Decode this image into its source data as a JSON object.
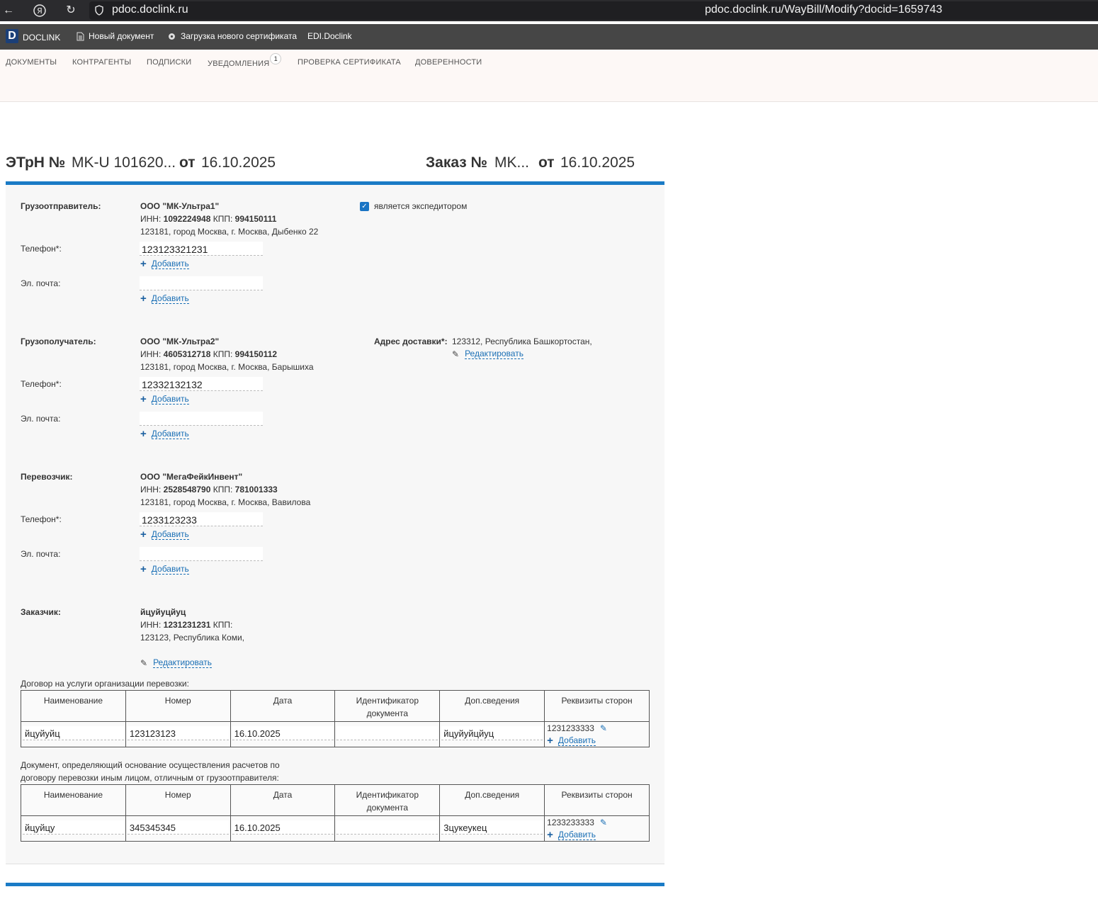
{
  "browser": {
    "host": "pdoc.doclink.ru",
    "url": "pdoc.doclink.ru/WayBill/Modify?docid=1659743"
  },
  "appbar": {
    "logo_letter": "D",
    "brand": "DOCLINK",
    "new_doc": "Новый документ",
    "upload_cert": "Загрузка нового сертификата",
    "edi": "EDI.Doclink"
  },
  "nav": {
    "documents": "ДОКУМЕНТЫ",
    "counterparties": "КОНТРАГЕНТЫ",
    "subscriptions": "ПОДПИСКИ",
    "notifications": "УВЕДОМЛЕНИЯ",
    "notifications_count": "1",
    "cert_check": "ПРОВЕРКА СЕРТИФИКАТА",
    "powers": "ДОВЕРЕННОСТИ"
  },
  "title": {
    "etrn_label": "ЭТрН №",
    "etrn_number": "MK-U 101620...",
    "from1": "от",
    "date1": "16.10.2025",
    "order_label": "Заказ №",
    "order_number": "MK...",
    "from2": "от",
    "date2": "16.10.2025"
  },
  "labels": {
    "phone": "Телефон*:",
    "email": "Эл. почта:",
    "add": "Добавить",
    "edit": "Редактировать",
    "inn": "ИНН:",
    "kpp": "КПП:"
  },
  "shipper": {
    "label": "Грузоотправитель:",
    "name": "ООО \"МК-Ультра1\"",
    "inn": "1092224948",
    "kpp": "994150111",
    "address": "123181, город Москва, г. Москва, Дыбенко 22",
    "phone": "123123321231",
    "email": "",
    "forwarder_label": "является экспедитором"
  },
  "consignee": {
    "label": "Грузополучатель:",
    "name": "ООО \"МК-Ультра2\"",
    "inn": "4605312718",
    "kpp": "994150112",
    "address": "123181, город Москва, г. Москва, Барышиха",
    "phone": "12332132132",
    "email": "",
    "delivery_label": "Адрес доставки*:",
    "delivery_address": "123312, Республика Башкортостан,"
  },
  "carrier": {
    "label": "Перевозчик:",
    "name": "ООО \"МегаФейкИнвент\"",
    "inn": "2528548790",
    "kpp": "781001333",
    "address": "123181, город Москва, г. Москва, Вавилова",
    "phone": "1233123233",
    "email": ""
  },
  "customer": {
    "label": "Заказчик:",
    "name": "йцуйуцйуц",
    "inn": "1231231231",
    "kpp": "",
    "address": "123123, Республика Коми,"
  },
  "table_headers": [
    "Наименование",
    "Номер",
    "Дата",
    "Идентификатор документа",
    "Доп.сведения",
    "Реквизиты сторон"
  ],
  "contract": {
    "caption": "Договор на услуги организации перевозки:",
    "row": {
      "name": "йцуйуйц",
      "number": "123123123",
      "date": "16.10.2025",
      "identifier": "",
      "extra": "йцуйуйцйуц",
      "requisites": "1231233333"
    }
  },
  "settlement": {
    "caption_line1": "Документ, определяющий основание осуществления расчетов по",
    "caption_line2": "договору перевозки иным лицом, отличным от грузоотправителя:",
    "row": {
      "name": "йцуйцу",
      "number": "345345345",
      "date": "16.10.2025",
      "identifier": "",
      "extra": "3цукеукец",
      "requisites": "1233233333"
    }
  }
}
